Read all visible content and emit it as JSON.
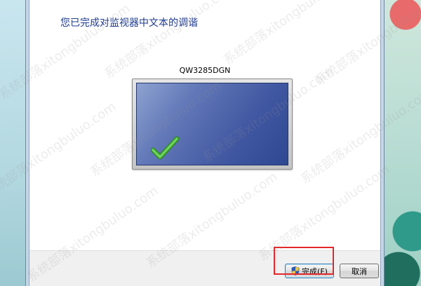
{
  "dialog": {
    "heading": "您已完成对监视器中文本的调谐",
    "monitor_name": "QW3285DGN",
    "status_icon": "checkmark-icon"
  },
  "buttons": {
    "finish_label": "完成(F)",
    "finish_icon": "uac-shield-icon",
    "cancel_label": "取消"
  },
  "watermark": {
    "text": "系统部落xitongbuluo.com"
  },
  "colors": {
    "heading": "#1e3b8c",
    "highlight": "#e5262a",
    "check": "#3aa52e"
  }
}
